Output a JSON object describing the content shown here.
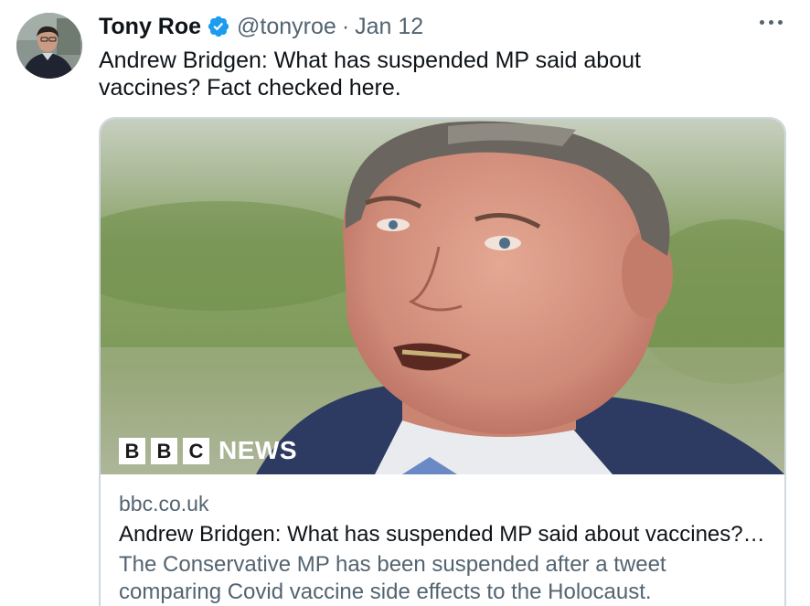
{
  "tweet": {
    "author_name": "Tony Roe",
    "handle": "@tonyroe",
    "separator": "·",
    "date": "Jan 12",
    "text": "Andrew Bridgen: What has suspended MP said about vaccines? Fact checked here.",
    "verified": true,
    "icons": {
      "verified": "verified-badge-icon",
      "more": "more-options-icon"
    }
  },
  "card": {
    "logo": {
      "letters": [
        "B",
        "B",
        "C"
      ],
      "word": "NEWS"
    },
    "domain": "bbc.co.uk",
    "title": "Andrew Bridgen: What has suspended MP said about vaccines? Fact checked here.",
    "description": "The Conservative MP has been suspended after a tweet comparing Covid vaccine side effects to the Holocaust."
  },
  "colors": {
    "accent": "#1d9bf0",
    "text_primary": "#0f1419",
    "text_secondary": "#536471",
    "border": "#cfd9de"
  }
}
